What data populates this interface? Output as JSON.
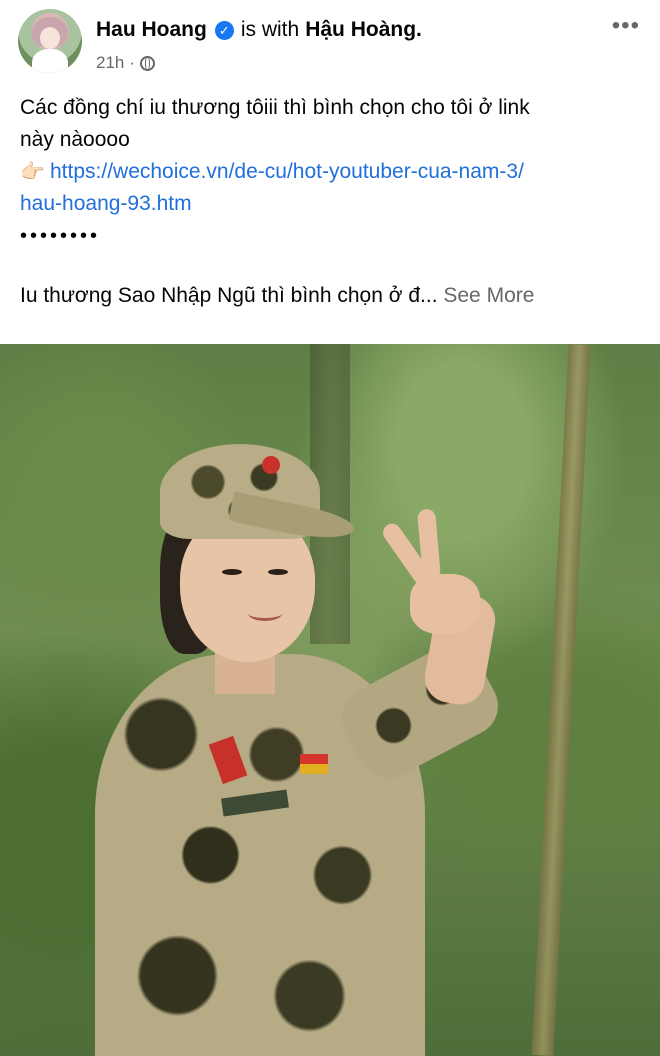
{
  "post": {
    "author_name": "Hau Hoang",
    "with_text": "is with",
    "tagged_name": "Hậu Hoàng.",
    "time": "21h",
    "more_icon": "more-horizontal-icon",
    "text_line1": "Các đồng chí iu thương tôiii thì bình chọn cho tôi ở link",
    "text_line2": "này nàoooo",
    "link_emoji": "👉🏻",
    "link_line1": "https://wechoice.vn/de-cu/hot-youtuber-cua-nam-3/",
    "link_line2": "hau-hoang-93.htm",
    "dots": "••••••••",
    "text_line3": "Iu thương Sao Nhập Ngũ thì bình chọn ở đ...",
    "see_more": "See More"
  },
  "colors": {
    "link": "#216fdb",
    "secondary_text": "#65676b",
    "verified_badge": "#1877f2"
  }
}
